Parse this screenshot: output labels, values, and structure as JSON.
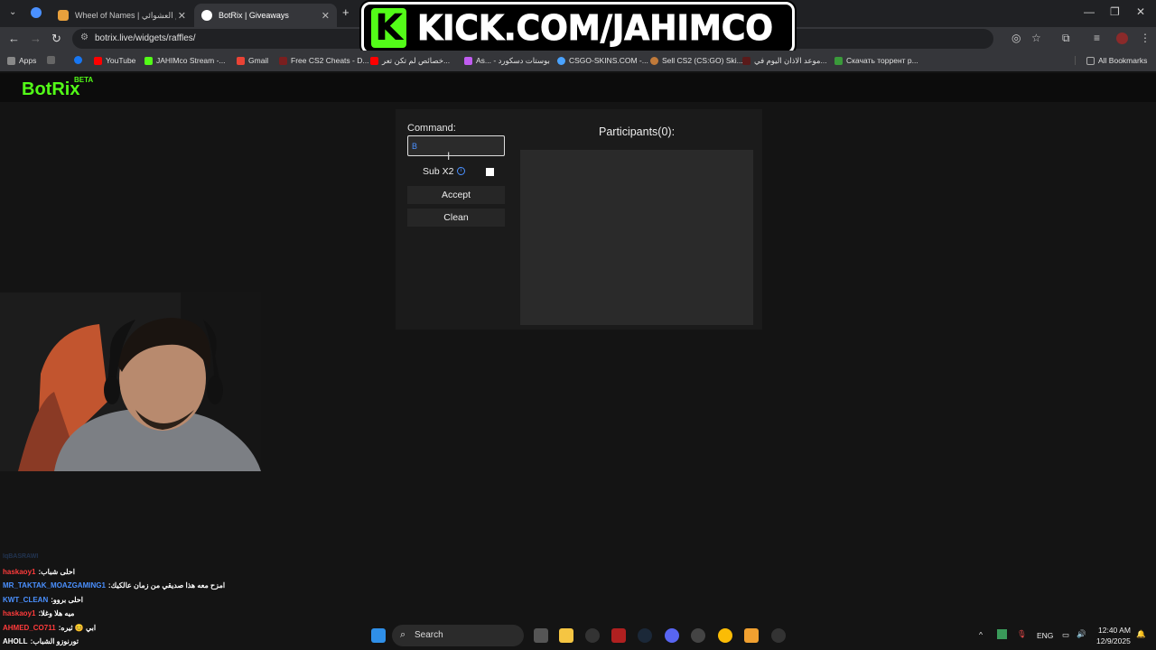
{
  "tabs": [
    {
      "label": "Wheel of Names | اسم العشوائي",
      "active": false
    },
    {
      "label": "BotRix | Giveaways",
      "active": true
    }
  ],
  "overlay": {
    "kick_letter": "K",
    "text": "KICK.COM/JAHIMCO"
  },
  "address_bar": {
    "url": "botrix.live/widgets/raffles/"
  },
  "bookmarks": {
    "items": [
      "Apps",
      "YouTube",
      "JAHIMco Stream -...",
      "Gmail",
      "Free CS2 Cheats - D...",
      "خصائص لم تكن تعر...",
      "As... - بوستات دسكورد",
      "CSGO-SKINS.COM -...",
      "Sell CS2 (CS:GO) Ski...",
      "موعد الاذان اليوم في...",
      "Скачать торрент р..."
    ],
    "all": "All Bookmarks"
  },
  "botrix": {
    "logo": "BotRix",
    "beta": "BETA"
  },
  "widget": {
    "command_label": "Command:",
    "command_value": "B",
    "sub_label": "Sub X2",
    "accept": "Accept",
    "clean": "Clean",
    "participants": "Participants(0):"
  },
  "chat": {
    "lines": [
      {
        "user": "haskaoy1",
        "msg": "احلى شباب",
        "color": "#ff3b3b"
      },
      {
        "user": "MR_TAKTAK_MOAZGAMING1",
        "msg": "امزح معه هذا صديقي من زمان عالكيك",
        "color": "#4a90ff"
      },
      {
        "user": "KWT_CLEAN",
        "msg": "احلى بروو",
        "color": "#4a90ff"
      },
      {
        "user": "haskaoy1",
        "msg": "ميه هلا وغلا",
        "color": "#ff3b3b"
      },
      {
        "user": "AHMED_CO711",
        "msg": "ابي 😊 ثيره",
        "color": "#ff3b3b"
      },
      {
        "user": "AHOLL",
        "msg": "تورنوزو الشباب",
        "color": "#ffffff"
      }
    ]
  },
  "taskbar": {
    "search": "Search",
    "lang": "ENG",
    "time": "12:40 AM",
    "date": "12/9/2025"
  }
}
